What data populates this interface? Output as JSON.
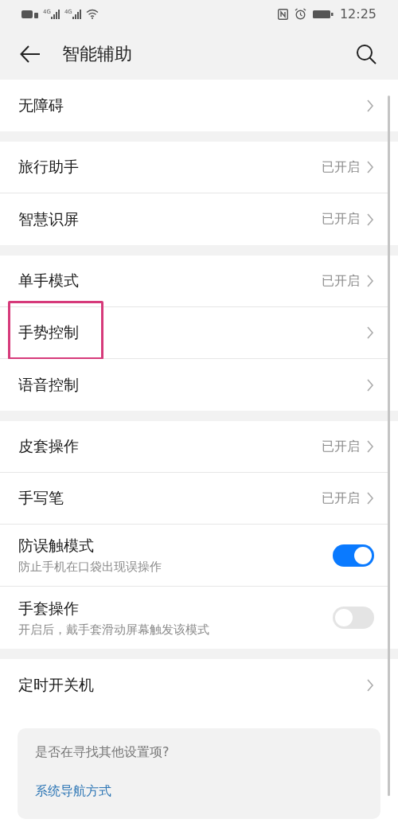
{
  "status_bar": {
    "network_labels": [
      "4G",
      "4G"
    ],
    "time": "12:25"
  },
  "header": {
    "title": "智能辅助"
  },
  "groups": [
    {
      "items": [
        {
          "kind": "link",
          "label": "无障碍",
          "highlighted": false
        }
      ]
    },
    {
      "items": [
        {
          "kind": "link",
          "label": "旅行助手",
          "value": "已开启",
          "highlighted": false
        },
        {
          "kind": "link",
          "label": "智慧识屏",
          "value": "已开启",
          "highlighted": false
        }
      ]
    },
    {
      "items": [
        {
          "kind": "link",
          "label": "单手模式",
          "value": "已开启",
          "highlighted": false
        },
        {
          "kind": "link",
          "label": "手势控制",
          "highlighted": true
        },
        {
          "kind": "link",
          "label": "语音控制",
          "highlighted": false
        }
      ]
    },
    {
      "items": [
        {
          "kind": "link",
          "label": "皮套操作",
          "value": "已开启",
          "highlighted": false
        },
        {
          "kind": "link",
          "label": "手写笔",
          "value": "已开启",
          "highlighted": false
        },
        {
          "kind": "toggle",
          "label": "防误触模式",
          "subtitle": "防止手机在口袋出现误操作",
          "on": true,
          "highlighted": false
        },
        {
          "kind": "toggle",
          "label": "手套操作",
          "subtitle": "开启后，戴手套滑动屏幕触发该模式",
          "on": false,
          "highlighted": false
        }
      ]
    },
    {
      "items": [
        {
          "kind": "link",
          "label": "定时开关机",
          "highlighted": false
        }
      ]
    }
  ],
  "tip_card": {
    "title": "是否在寻找其他设置项?",
    "link": "系统导航方式"
  }
}
